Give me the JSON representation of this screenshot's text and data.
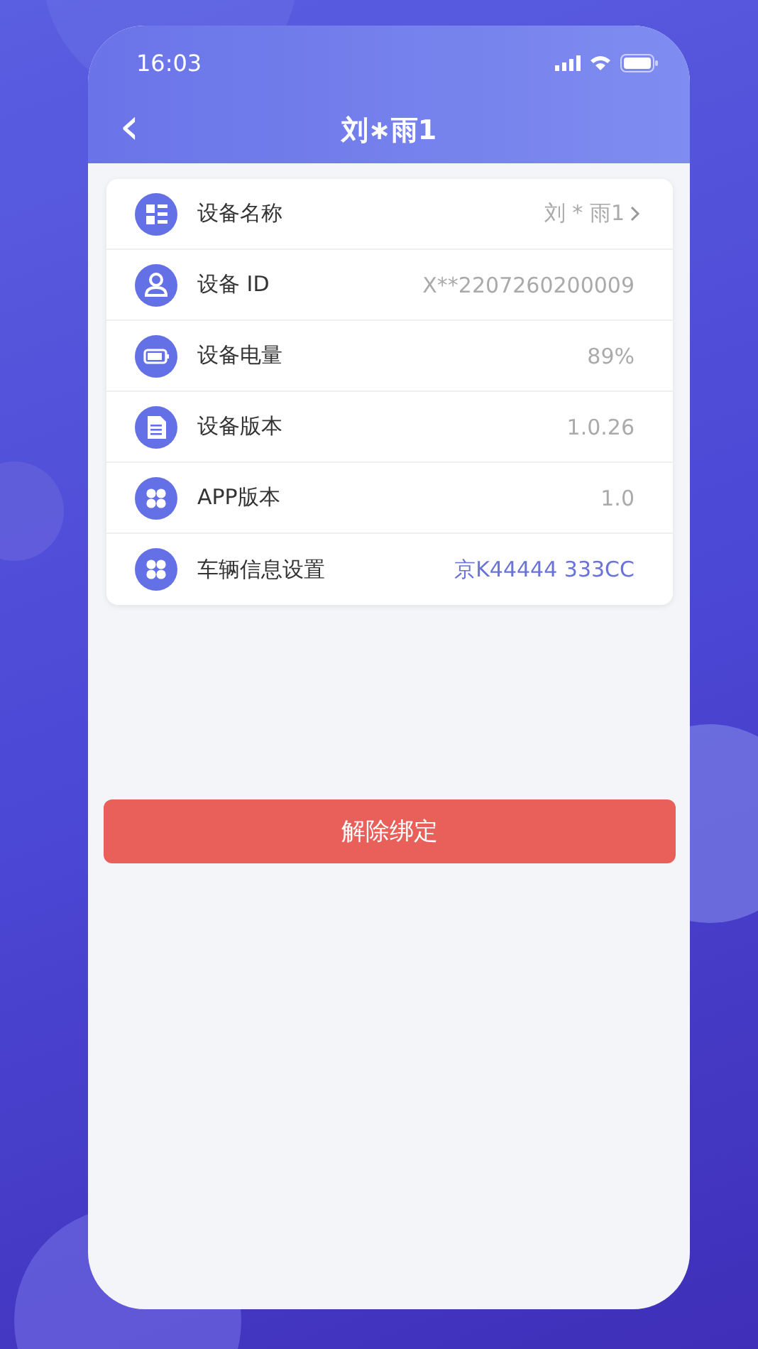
{
  "status_bar": {
    "time": "16:03"
  },
  "nav_bar": {
    "back_icon": "‹",
    "title": "刘∗雨1"
  },
  "settings": [
    {
      "kind": "grid",
      "label": "设备名称",
      "value": "刘 * 雨1",
      "chevron": true,
      "accent": false
    },
    {
      "kind": "person",
      "label": "设备 ID",
      "value": "X**2207260200009",
      "chevron": false,
      "accent": false
    },
    {
      "kind": "battery",
      "label": "设备电量",
      "value": "89%",
      "chevron": false,
      "accent": false
    },
    {
      "kind": "document",
      "label": "设备版本",
      "value": "1.0.26",
      "chevron": false,
      "accent": false
    },
    {
      "kind": "apps",
      "label": "APP版本",
      "value": "1.0",
      "chevron": false,
      "accent": false
    },
    {
      "kind": "apps",
      "label": "车辆信息设置",
      "value": "京K44444 333CC",
      "chevron": false,
      "accent": true
    }
  ],
  "unbind_button": "解除绑定"
}
